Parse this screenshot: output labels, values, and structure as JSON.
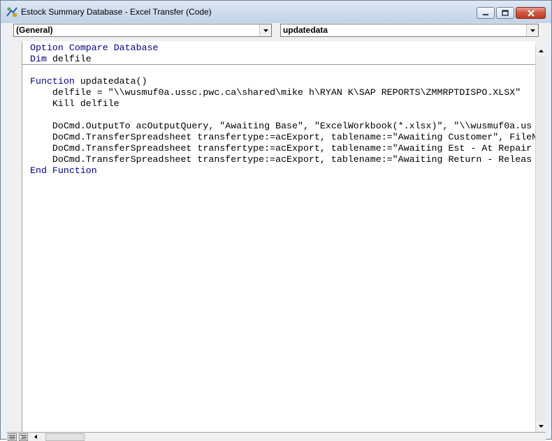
{
  "window": {
    "title": "Estock Summary Database - Excel Transfer (Code)",
    "icon": "vba-code-icon"
  },
  "toolbar": {
    "object_combo": "(General)",
    "procedure_combo": "updatedata"
  },
  "code": {
    "declarations": [
      [
        {
          "t": "Option Compare Database",
          "k": true
        }
      ],
      [
        {
          "t": "Dim",
          "k": true
        },
        {
          "t": " delfile",
          "k": false
        }
      ]
    ],
    "procedure": [
      [
        {
          "t": "Function",
          "k": true
        },
        {
          "t": " updatedata()",
          "k": false
        }
      ],
      [
        {
          "t": "    delfile = \"\\\\wusmuf0a.ussc.pwc.ca\\shared\\mike h\\RYAN K\\SAP REPORTS\\ZMMRPTDISPO.XLSX\"",
          "k": false
        }
      ],
      [
        {
          "t": "    Kill delfile",
          "k": false
        }
      ],
      [
        {
          "t": "",
          "k": false
        }
      ],
      [
        {
          "t": "    DoCmd.OutputTo acOutputQuery, \"Awaiting Base\", \"ExcelWorkbook(*.xlsx)\", \"\\\\wusmuf0a.us",
          "k": false
        }
      ],
      [
        {
          "t": "    DoCmd.TransferSpreadsheet transfertype:=acExport, tablename:=\"Awaiting Customer\", FileN",
          "k": false
        }
      ],
      [
        {
          "t": "    DoCmd.TransferSpreadsheet transfertype:=acExport, tablename:=\"Awaiting Est - At Repair",
          "k": false
        }
      ],
      [
        {
          "t": "    DoCmd.TransferSpreadsheet transfertype:=acExport, tablename:=\"Awaiting Return - Releas",
          "k": false
        }
      ],
      [
        {
          "t": "End Function",
          "k": true
        }
      ]
    ]
  },
  "colors": {
    "keyword": "#00007f",
    "text": "#000000",
    "titlebar": "#cddbec",
    "close_button": "#c94a33"
  }
}
